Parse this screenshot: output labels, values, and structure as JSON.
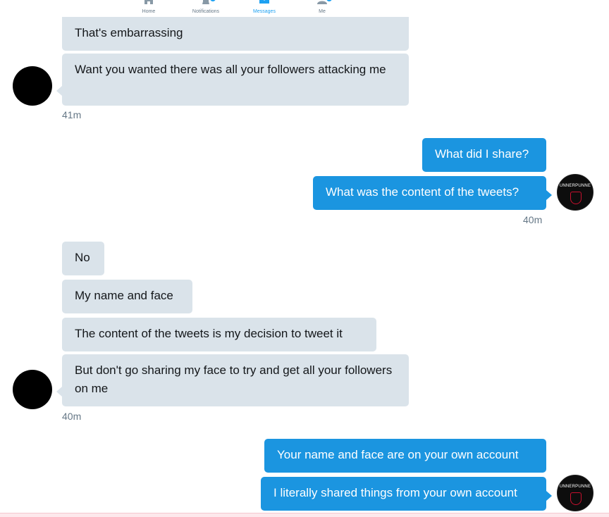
{
  "nav": {
    "items": [
      {
        "label": "Home",
        "icon": "home-icon"
      },
      {
        "label": "Notifications",
        "icon": "bell-icon"
      },
      {
        "label": "Messages",
        "icon": "envelope-icon",
        "active": true
      },
      {
        "label": "Me",
        "icon": "person-icon"
      }
    ]
  },
  "messages": [
    {
      "from": "them",
      "text": "That's embarrassing"
    },
    {
      "from": "them",
      "text": "Want you wanted there was all your followers attacking me"
    },
    {
      "from": "me",
      "text": "What did I share?"
    },
    {
      "from": "me",
      "text": "What was the content of the tweets?"
    },
    {
      "from": "them",
      "text": "No"
    },
    {
      "from": "them",
      "text": "My name and face"
    },
    {
      "from": "them",
      "text": "The content of the tweets is my decision to tweet it"
    },
    {
      "from": "them",
      "text": "But don't go sharing my face to try and get all your followers on me"
    },
    {
      "from": "me",
      "text": "Your name and face are on your own account"
    },
    {
      "from": "me",
      "text": "I literally shared things from your own account"
    }
  ],
  "timestamps": [
    "41m",
    "40m",
    "40m"
  ],
  "my_avatar": {
    "text": "UNNERPUNNE"
  },
  "colors": {
    "incoming_bubble": "#dae3ea",
    "outgoing_bubble": "#1b95e0",
    "accent": "#1da1f2"
  }
}
